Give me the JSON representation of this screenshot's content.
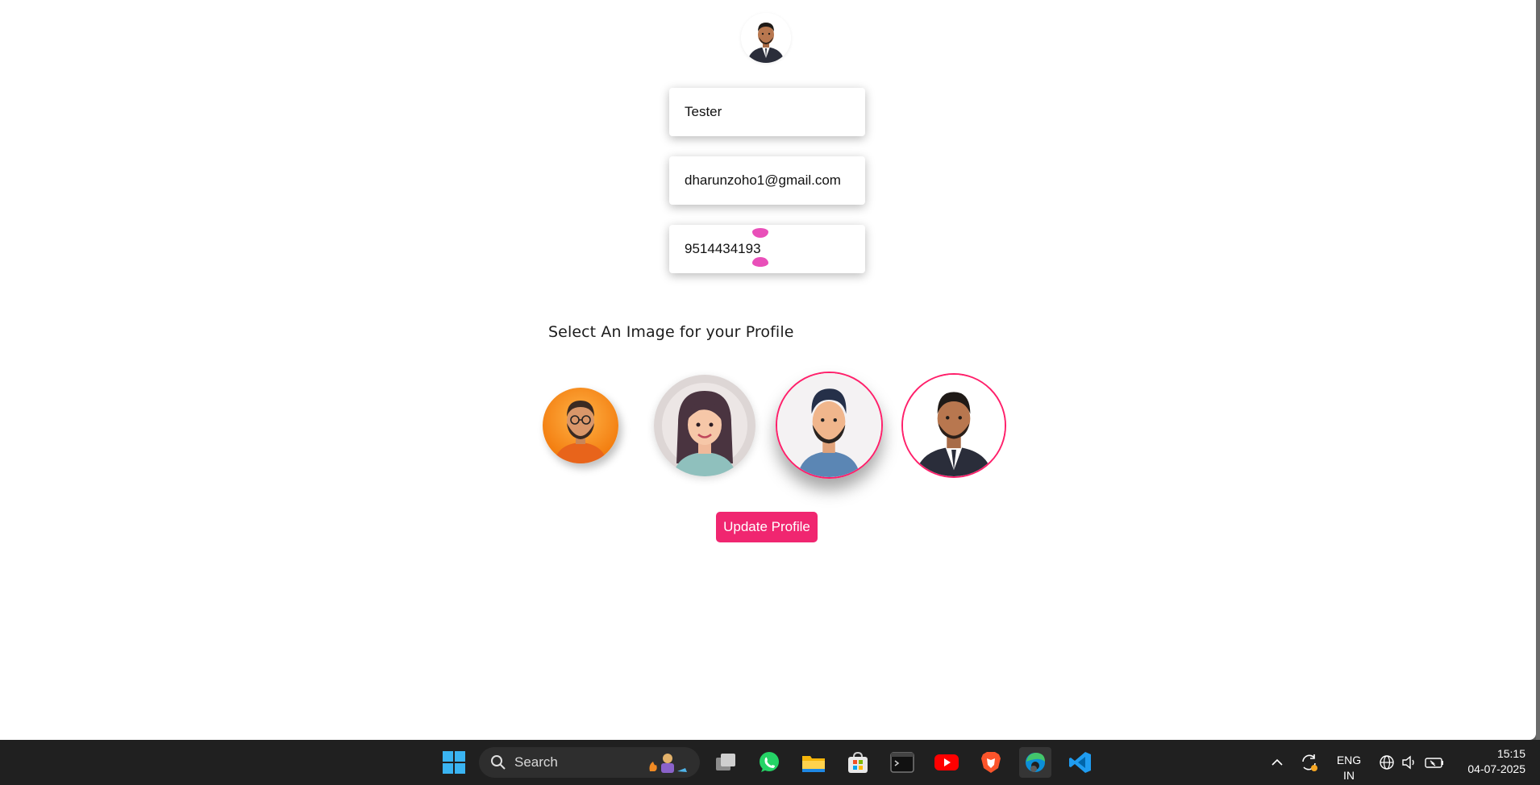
{
  "form": {
    "name_value": "Tester",
    "email_value": "dharunzoho1@gmail.com",
    "phone_value": "9514434193"
  },
  "avatar_section": {
    "label": "Select An Image for your Profile",
    "options": [
      {
        "icon": "bearded-man-glasses-orange-avatar"
      },
      {
        "icon": "woman-avatar"
      },
      {
        "icon": "bearded-man-blue-shirt-avatar",
        "selected": true
      },
      {
        "icon": "man-in-suit-avatar",
        "selected": true
      }
    ]
  },
  "actions": {
    "update_label": "Update Profile"
  },
  "colors": {
    "accent": "#f02670",
    "selected_border": "#ff1f6a",
    "cursor_marker": "#e94fb9",
    "taskbar": "#202020"
  },
  "taskbar": {
    "search_placeholder": "Search",
    "apps": [
      "windows-start-icon",
      "task-view-icon",
      "whatsapp-icon",
      "file-explorer-icon",
      "microsoft-store-icon",
      "terminal-icon",
      "youtube-icon",
      "brave-icon",
      "edge-icon",
      "vscode-icon"
    ],
    "language_line1": "ENG",
    "language_line2": "IN",
    "time": "15:15",
    "date": "04-07-2025"
  }
}
